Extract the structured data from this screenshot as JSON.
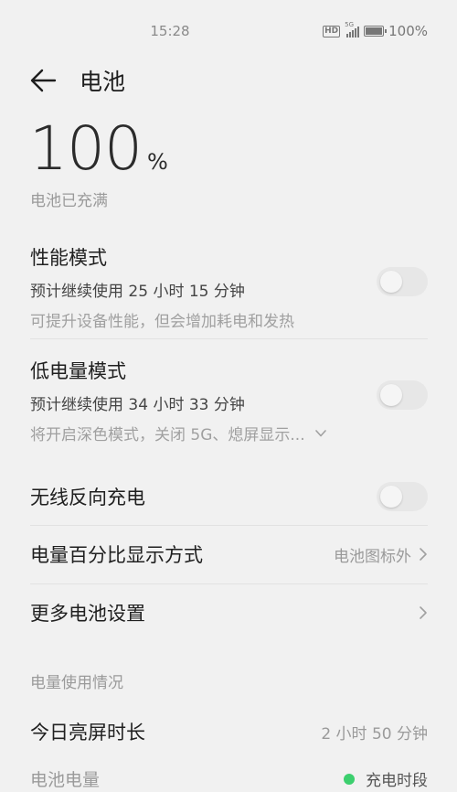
{
  "status_bar": {
    "time": "15:28",
    "hd": "HD",
    "network": "5G",
    "battery_pct": "100%",
    "battery_level": 1.0
  },
  "header": {
    "back_icon": "arrow-left-icon",
    "title": "电池"
  },
  "battery": {
    "level": "100",
    "unit": "%",
    "state": "电池已充满"
  },
  "performance_mode": {
    "title": "性能模式",
    "estimate": "预计继续使用 25 小时 15 分钟",
    "description": "可提升设备性能，但会增加耗电和发热",
    "enabled": false
  },
  "power_saving_mode": {
    "title": "低电量模式",
    "estimate": "预计继续使用 34 小时 33 分钟",
    "description": "将开启深色模式，关闭 5G、熄屏显示...",
    "expand_icon": "chevron-down-icon",
    "enabled": false
  },
  "reverse_charging": {
    "label": "无线反向充电",
    "enabled": false
  },
  "percentage_display": {
    "label": "电量百分比显示方式",
    "value": "电池图标外",
    "icon": "chevron-right-icon"
  },
  "more_settings": {
    "label": "更多电池设置",
    "icon": "chevron-right-icon"
  },
  "usage": {
    "section_title": "电量使用情况",
    "screen_on_label": "今日亮屏时长",
    "screen_on_value": "2 小时 50 分钟",
    "level_label": "电池电量",
    "legend_label": "充电时段",
    "legend_color": "#3ccf6e"
  }
}
